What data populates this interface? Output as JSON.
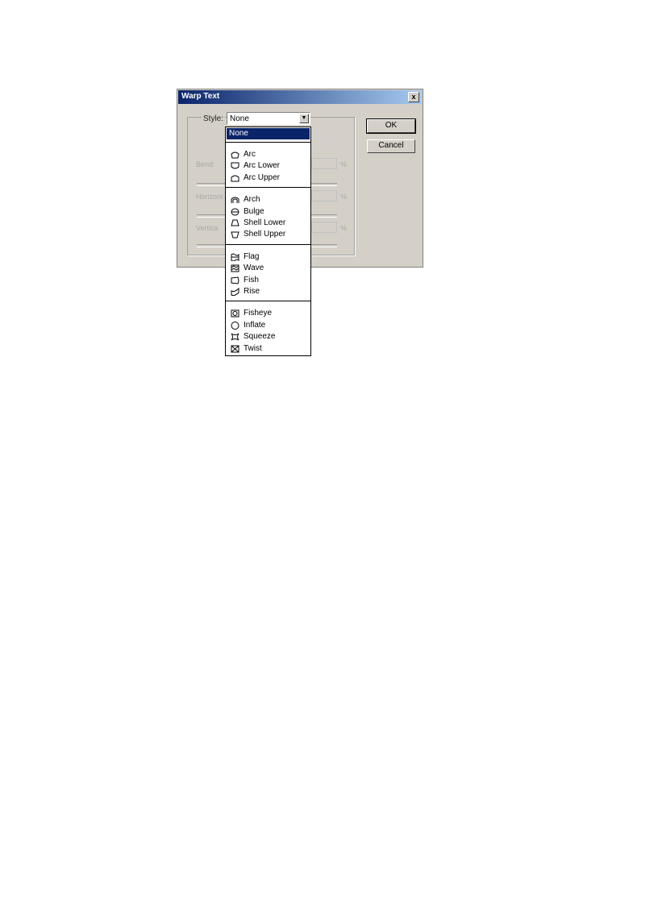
{
  "dialog": {
    "title": "Warp Text",
    "close_label": "x",
    "style_label": "Style:",
    "style_value": "None",
    "ok_label": "OK",
    "cancel_label": "Cancel"
  },
  "disabled": {
    "bend_label": "Bend:",
    "horizontal_label": "Horizont",
    "vertical_label": "Vertica",
    "percent": "%"
  },
  "style_menu": {
    "selected": "None",
    "groups": [
      [
        {
          "label": "Arc",
          "icon": "arc-icon"
        },
        {
          "label": "Arc Lower",
          "icon": "arc-lower-icon"
        },
        {
          "label": "Arc Upper",
          "icon": "arc-upper-icon"
        }
      ],
      [
        {
          "label": "Arch",
          "icon": "arch-icon"
        },
        {
          "label": "Bulge",
          "icon": "bulge-icon"
        },
        {
          "label": "Shell Lower",
          "icon": "shell-lower-icon"
        },
        {
          "label": "Shell Upper",
          "icon": "shell-upper-icon"
        }
      ],
      [
        {
          "label": "Flag",
          "icon": "flag-icon"
        },
        {
          "label": "Wave",
          "icon": "wave-icon"
        },
        {
          "label": "Fish",
          "icon": "fish-icon"
        },
        {
          "label": "Rise",
          "icon": "rise-icon"
        }
      ],
      [
        {
          "label": "Fisheye",
          "icon": "fisheye-icon"
        },
        {
          "label": "Inflate",
          "icon": "inflate-icon"
        },
        {
          "label": "Squeeze",
          "icon": "squeeze-icon"
        },
        {
          "label": "Twist",
          "icon": "twist-icon"
        }
      ]
    ]
  }
}
